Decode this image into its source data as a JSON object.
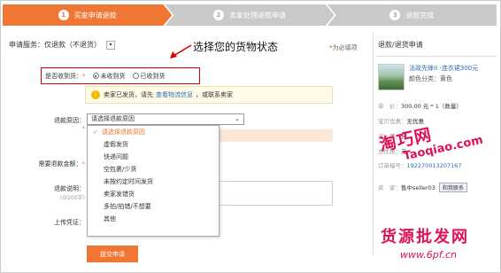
{
  "steps": [
    {
      "num": "1",
      "label": "买家申请退款"
    },
    {
      "num": "2",
      "label": "卖家处理退款申请"
    },
    {
      "num": "3",
      "label": "退款完成"
    }
  ],
  "service": {
    "label": "申请服务：仅退款（不退货）",
    "toggle": "▾"
  },
  "callout": "选择您的货物状态",
  "required_note": {
    "star": "*",
    "text": "为必填项"
  },
  "received": {
    "label": "是否收到货：",
    "star": "*",
    "options": [
      "未收到货",
      "已收到货"
    ],
    "selected": 0
  },
  "tip": {
    "icon": "!",
    "pre": "卖家已发货，请先",
    "link": "查看物流信息",
    "post": "，或联系卖家"
  },
  "reason": {
    "label": "退款原因：",
    "star": "*",
    "placeholder": "请选择退款原因",
    "caret": "⌄",
    "options": [
      "请选择退款原因",
      "虚假发货",
      "快递问题",
      "空包裹/少货",
      "未按约定时间发货",
      "卖家发错货",
      "多拍/拍错/不想要",
      "其他"
    ],
    "check": "✓"
  },
  "amount": {
    "label": "需要退款金额：",
    "star": "*"
  },
  "explain": {
    "label": "退款说明：",
    "sub": "(0/200字)"
  },
  "upload": {
    "label": "上传凭证："
  },
  "submit": "提交申请",
  "right_panel": {
    "title": "退款/退货申请",
    "product_title": "法政先锋II -连衣裙300元",
    "product_color": "颜色分类：黄色",
    "rows": [
      {
        "k": "单　价：",
        "v": "300.00 元 * 1（数量）"
      },
      {
        "k": "宝贝优惠：",
        "v": "无优惠"
      },
      {
        "k": "运　费：",
        "v": "元"
      },
      {
        "k": "总优惠：",
        "v": "元"
      },
      {
        "k": "订单编号：",
        "v": "192270013207167"
      },
      {
        "k": "卖　家：",
        "v": "售中seller03",
        "badge": "和我联系"
      }
    ]
  },
  "watermarks": [
    "淘巧网",
    "Taoqiao.com",
    "货源批发网",
    "www.6pf.cn"
  ],
  "colors": {
    "accent": "#f07733",
    "highlight": "#d00000",
    "link": "#2a6db0",
    "watermark": "#e0105a"
  }
}
